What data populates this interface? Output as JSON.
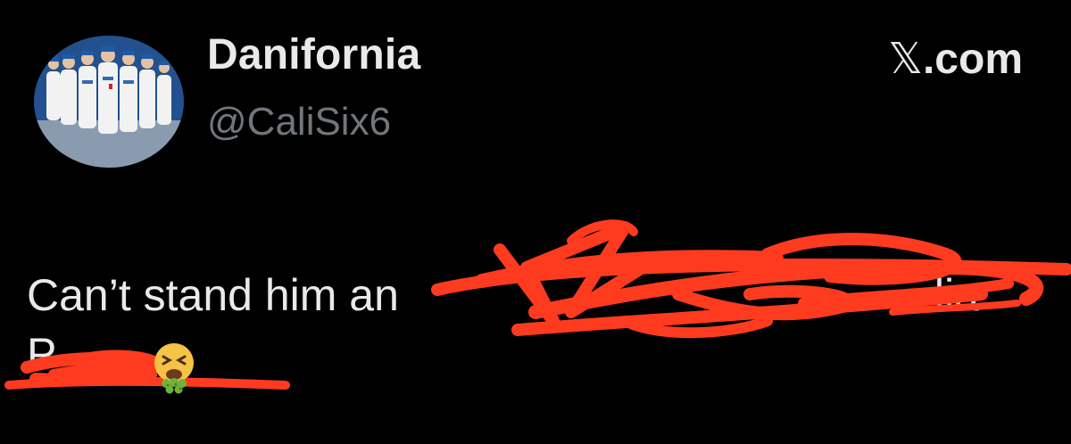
{
  "author": {
    "display_name": "Danifornia",
    "handle": "@CaliSix6",
    "avatar_icon": "baseball-team-photo"
  },
  "header": {
    "site": ".com",
    "site_icon": "x-logo"
  },
  "tweet": {
    "visible_text": "Can’t stand him an",
    "redacted_line_1_suffix": "lia",
    "redacted_line_2": "P",
    "emoji_icon": "vomiting-face-emoji"
  },
  "colors": {
    "background": "#000000",
    "primary_text": "#e7e9ea",
    "secondary_text": "#71767b",
    "redaction_scribble": "#ff3b1f"
  }
}
